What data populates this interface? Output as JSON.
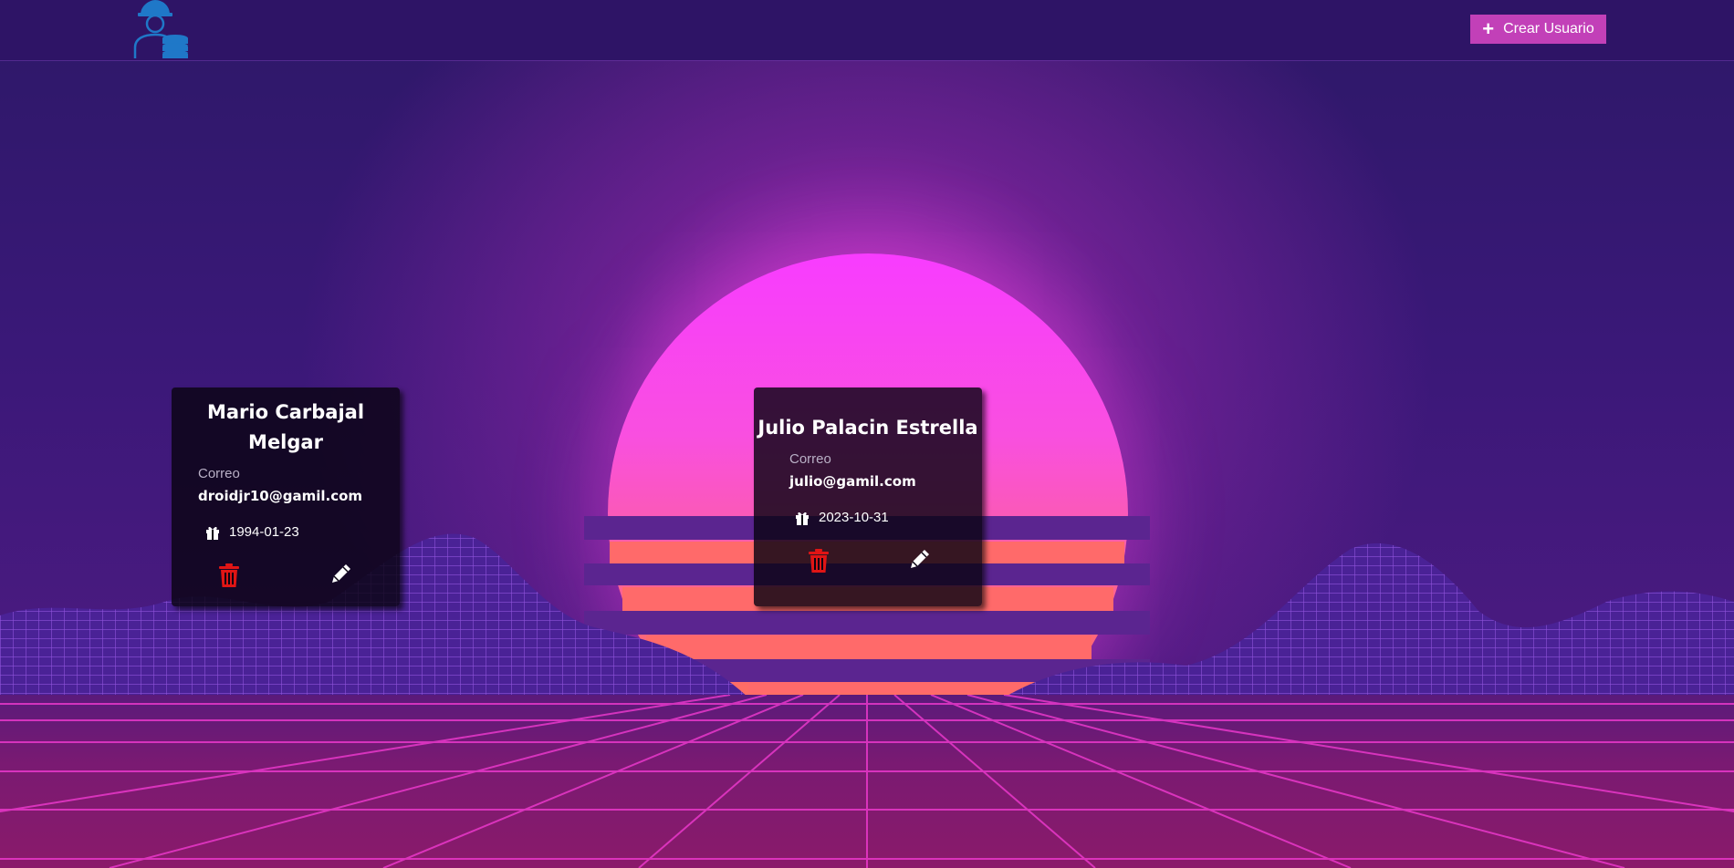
{
  "header": {
    "logo_icon": "engineer-database-icon",
    "create_button_label": "Crear Usuario",
    "create_button_icon": "plus-icon",
    "button_color": "#c240b8"
  },
  "users": [
    {
      "name": "Mario Carbajal Melgar",
      "email_label": "Correo",
      "email": "droidjr10@gamil.com",
      "birthdate": "1994-01-23",
      "delete_icon": "trash-icon",
      "edit_icon": "pencil-icon"
    },
    {
      "name": "Julio Palacin Estrella",
      "email_label": "Correo",
      "email": "julio@gamil.com",
      "birthdate": "2023-10-31",
      "delete_icon": "trash-icon",
      "edit_icon": "pencil-icon"
    }
  ],
  "colors": {
    "delete": "#e01515",
    "edit": "#ffffff",
    "card_background": "#0a0412"
  }
}
